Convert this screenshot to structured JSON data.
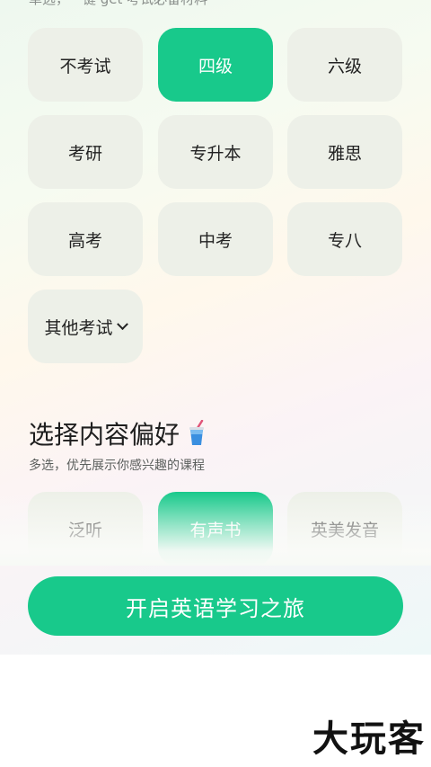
{
  "top_hint": "单选，一键 get 考试必备材料",
  "exam_options": [
    {
      "label": "不考试",
      "selected": false
    },
    {
      "label": "四级",
      "selected": true
    },
    {
      "label": "六级",
      "selected": false
    },
    {
      "label": "考研",
      "selected": false
    },
    {
      "label": "专升本",
      "selected": false
    },
    {
      "label": "雅思",
      "selected": false
    },
    {
      "label": "高考",
      "selected": false
    },
    {
      "label": "中考",
      "selected": false
    },
    {
      "label": "专八",
      "selected": false
    },
    {
      "label": "其他考试",
      "selected": false
    }
  ],
  "content_section": {
    "title": "选择内容偏好",
    "subtitle": "多选，优先展示你感兴趣的课程",
    "options": [
      {
        "label": "泛听",
        "selected": false
      },
      {
        "label": "有声书",
        "selected": true
      },
      {
        "label": "英美发音",
        "selected": false
      }
    ]
  },
  "cta": {
    "label": "开启英语学习之旅"
  },
  "watermark": "大玩客",
  "colors": {
    "accent": "#18c98b",
    "chip_bg": "#edf0e8"
  }
}
